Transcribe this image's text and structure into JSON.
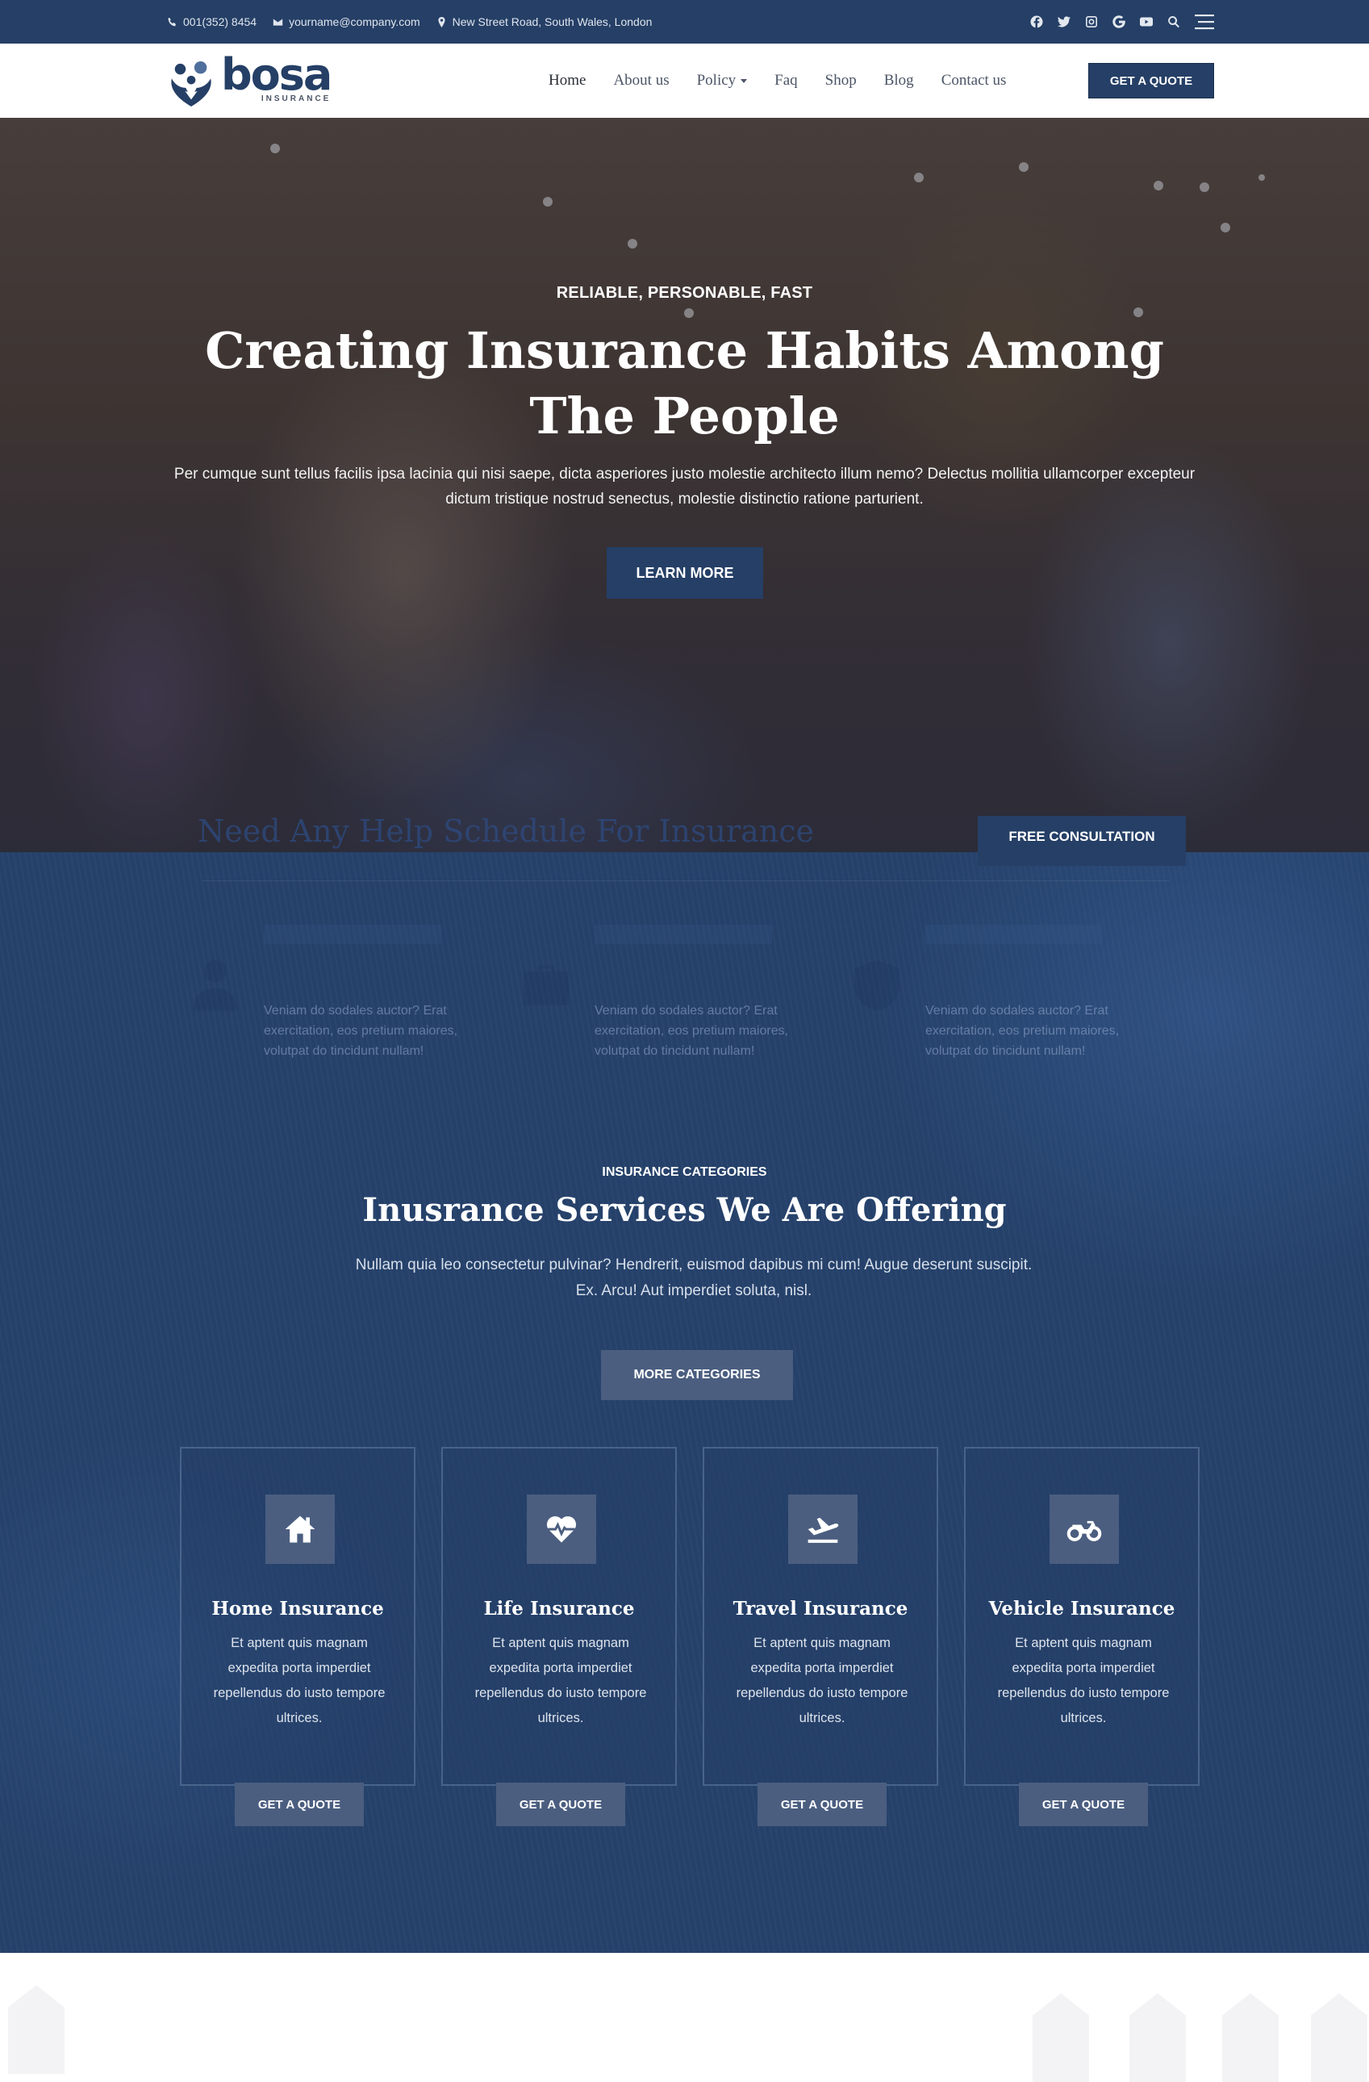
{
  "topbar": {
    "phone": "001(352) 8454",
    "email": "yourname@company.com",
    "address": "New Street Road, South Wales, London",
    "social_icons": [
      "facebook-icon",
      "twitter-icon",
      "instagram-icon",
      "google-icon",
      "youtube-icon"
    ],
    "search_icon": "search-icon",
    "menu_icon": "hamburger-menu-icon"
  },
  "header": {
    "logo_name": "bosa",
    "logo_sub": "INSURANCE",
    "nav": [
      {
        "label": "Home",
        "active": true
      },
      {
        "label": "About us"
      },
      {
        "label": "Policy",
        "dropdown": true
      },
      {
        "label": "Faq"
      },
      {
        "label": "Shop"
      },
      {
        "label": "Blog"
      },
      {
        "label": "Contact us"
      }
    ],
    "cta": "GET A QUOTE"
  },
  "hero": {
    "eyebrow": "RELIABLE, PERSONABLE, FAST",
    "title": "Creating Insurance Habits Among The People",
    "lead": "Per cumque sunt tellus facilis ipsa lacinia qui nisi saepe, dicta asperiores justo molestie architecto illum nemo? Delectus mollitia ullamcorper excepteur dictum tristique nostrud senectus, molestie distinctio ratione parturient.",
    "button": "LEARN MORE"
  },
  "help_banner": {
    "title": "Need Any Help Schedule For Insurance",
    "button": "FREE CONSULTATION"
  },
  "features": [
    {
      "text": "Veniam do sodales auctor? Erat exercitation, eos pretium maiores, volutpat do tincidunt nullam!"
    },
    {
      "text": "Veniam do sodales auctor? Erat exercitation, eos pretium maiores, volutpat do tincidunt nullam!"
    },
    {
      "text": "Veniam do sodales auctor? Erat exercitation, eos pretium maiores, volutpat do tincidunt nullam!"
    }
  ],
  "categories": {
    "eyebrow": "INSURANCE CATEGORIES",
    "title": "Inusrance Services We Are Offering",
    "lead": "Nullam quia leo consectetur pulvinar? Hendrerit, euismod dapibus mi cum! Augue deserunt suscipit. Ex. Arcu! Aut imperdiet soluta, nisl.",
    "more_button": "MORE CATEGORIES",
    "cards": [
      {
        "icon": "home-icon",
        "title": "Home Insurance",
        "text": "Et aptent quis magnam expedita porta imperdiet repellendus do iusto tempore ultrices.",
        "button": "GET A QUOTE"
      },
      {
        "icon": "heartbeat-icon",
        "title": "Life Insurance",
        "text": "Et aptent quis magnam expedita porta imperdiet repellendus do iusto tempore ultrices.",
        "button": "GET A QUOTE"
      },
      {
        "icon": "plane-departure-icon",
        "title": "Travel Insurance",
        "text": "Et aptent quis magnam expedita porta imperdiet repellendus do iusto tempore ultrices.",
        "button": "GET A QUOTE"
      },
      {
        "icon": "motorcycle-icon",
        "title": "Vehicle Insurance",
        "text": "Et aptent quis magnam expedita porta imperdiet repellendus do iusto tempore ultrices.",
        "button": "GET A QUOTE"
      }
    ]
  },
  "colors": {
    "brand": "#253f66",
    "muted_button": "#4b5e80",
    "nav_text": "#4c5566"
  }
}
